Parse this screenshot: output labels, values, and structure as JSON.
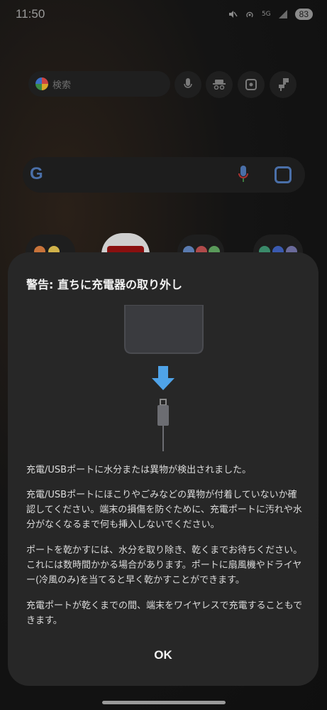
{
  "status_bar": {
    "time": "11:50",
    "network_label": "5G",
    "battery": "83"
  },
  "home": {
    "search_placeholder": "検索"
  },
  "dialog": {
    "title": "警告: 直ちに充電器の取り外し",
    "messages": [
      "充電/USBポートに水分または異物が検出されました。",
      "充電/USBポートにほこりやごみなどの異物が付着していないか確認してください。端末の損傷を防ぐために、充電ポートに汚れや水分がなくなるまで何も挿入しないでください。",
      "ポートを乾かすには、水分を取り除き、乾くまでお待ちください。これには数時間かかる場合があります。ポートに扇風機やドライヤー(冷風のみ)を当てると早く乾かすことができます。",
      "充電ポートが乾くまでの間、端末をワイヤレスで充電することもできます。"
    ],
    "ok_label": "OK"
  },
  "colors": {
    "dialog_bg": "#272727",
    "arrow": "#4fa3e8",
    "device": "#3a3b3f"
  }
}
